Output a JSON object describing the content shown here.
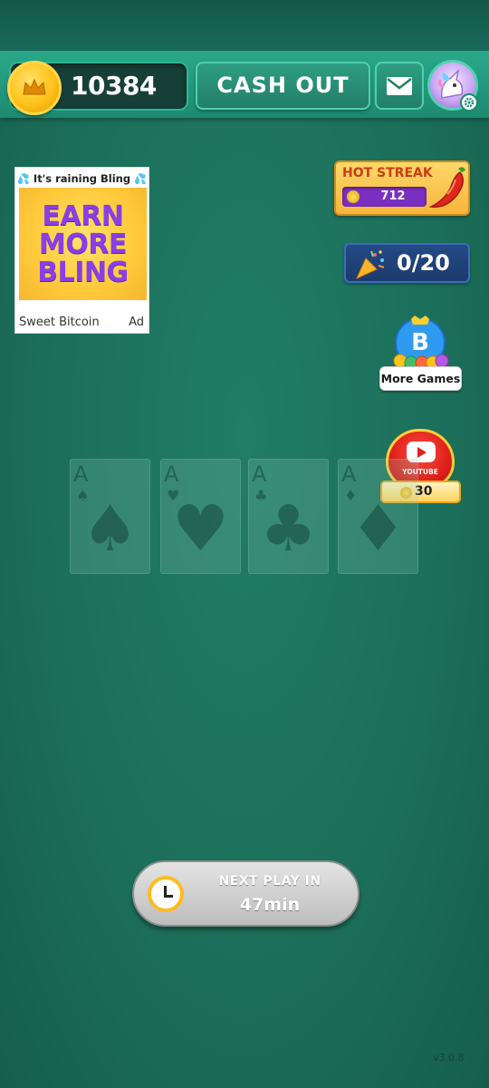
{
  "header": {
    "coin_balance": "10384",
    "cashout_label": "CASH OUT"
  },
  "ad": {
    "headline": "It's raining Bling",
    "banner_lines": [
      "EARN",
      "MORE",
      "BLING"
    ],
    "advertiser": "Sweet Bitcoin",
    "ad_label": "Ad"
  },
  "hot_streak": {
    "title": "HOT STREAK",
    "value": "712"
  },
  "progress": {
    "text": "0/20"
  },
  "more_games": {
    "label": "More Games",
    "logo_letter": "B"
  },
  "youtube": {
    "label": "YOUTUBE",
    "reward": "30"
  },
  "cards": [
    {
      "rank": "A",
      "suit": "♠"
    },
    {
      "rank": "A",
      "suit": "♥"
    },
    {
      "rank": "A",
      "suit": "♣"
    },
    {
      "rank": "A",
      "suit": "♦"
    }
  ],
  "next_play": {
    "title": "NEXT PLAY IN",
    "time": "47min"
  },
  "version": "v3.0.8",
  "icons": {
    "coin": "crown-coin-icon",
    "mail": "envelope-icon",
    "avatar": "unicorn-avatar",
    "settings": "gear-icon",
    "streak": "chili-pepper-icon",
    "progress": "party-popper-icon",
    "timer": "clock-icon"
  },
  "colors": {
    "felt": "#1d735d",
    "topbar": "#2aa88a",
    "coin": "#ffc21a",
    "ad_text": "#8a3ee8",
    "streak_bar": "#7b2fc2"
  }
}
